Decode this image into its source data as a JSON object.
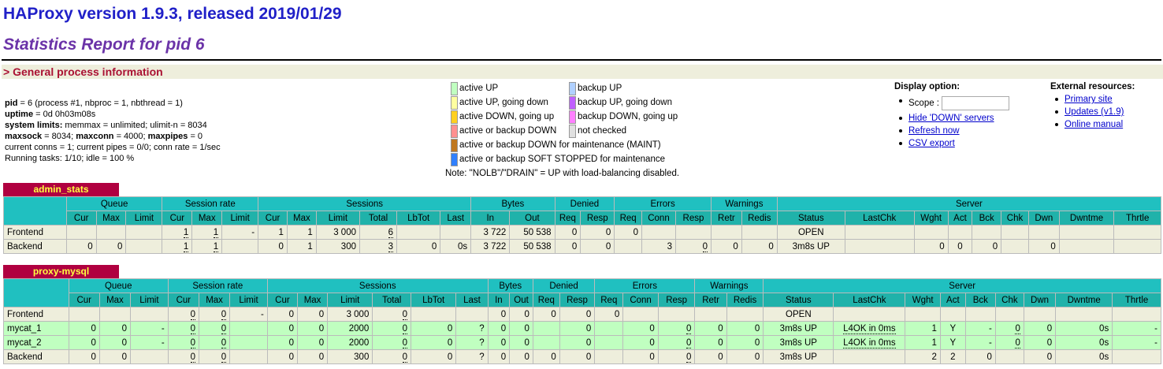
{
  "header": {
    "title": "HAProxy version 1.9.3, released 2019/01/29",
    "subtitle": "Statistics Report for pid 6",
    "section": "> General process information"
  },
  "process_info": {
    "line1_label": "pid",
    "line1_value": " = 6 (process #1, nbproc = 1, nbthread = 1)",
    "line2_label": "uptime",
    "line2_value": " = 0d 0h03m08s",
    "line3_label": "system limits:",
    "line3_value": " memmax = unlimited; ulimit-n = 8034",
    "line4_a_label": "maxsock",
    "line4_a_value": " = 8034; ",
    "line4_b_label": "maxconn",
    "line4_b_value": " = 4000; ",
    "line4_c_label": "maxpipes",
    "line4_c_value": " = 0",
    "line5": "current conns = 1; current pipes = 0/0; conn rate = 1/sec",
    "line6": "Running tasks: 1/10; idle = 100 %"
  },
  "legend": {
    "items": [
      {
        "label": "active UP",
        "color": "#c0ffc0"
      },
      {
        "label": "backup UP",
        "color": "#b0d0ff"
      },
      {
        "label": "active UP, going down",
        "color": "#ffffa0"
      },
      {
        "label": "backup UP, going down",
        "color": "#c060ff"
      },
      {
        "label": "active DOWN, going up",
        "color": "#ffd020"
      },
      {
        "label": "backup DOWN, going up",
        "color": "#ff80ff"
      },
      {
        "label": "active or backup DOWN",
        "color": "#ff9090"
      },
      {
        "label": "not checked",
        "color": "#e0e0e0"
      },
      {
        "label": "active or backup DOWN for maintenance (MAINT)",
        "color": "#c07820"
      },
      {
        "label": "active or backup SOFT STOPPED for maintenance",
        "color": "#3080ff"
      }
    ],
    "note": "Note: \"NOLB\"/\"DRAIN\" = UP with load-balancing disabled."
  },
  "display_options": {
    "title": "Display option:",
    "scope_label": "Scope :",
    "scope_value": "",
    "hide_down": "Hide 'DOWN' servers",
    "refresh": "Refresh now",
    "csv": "CSV export"
  },
  "external": {
    "title": "External resources:",
    "primary": "Primary site",
    "updates": "Updates (v1.9)",
    "manual": "Online manual"
  },
  "headers": {
    "groups": [
      "Queue",
      "Session rate",
      "Sessions",
      "Bytes",
      "Denied",
      "Errors",
      "Warnings",
      "Server"
    ],
    "cols": [
      "Cur",
      "Max",
      "Limit",
      "Cur",
      "Max",
      "Limit",
      "Cur",
      "Max",
      "Limit",
      "Total",
      "LbTot",
      "Last",
      "In",
      "Out",
      "Req",
      "Resp",
      "Req",
      "Conn",
      "Resp",
      "Retr",
      "Redis",
      "Status",
      "LastChk",
      "Wght",
      "Act",
      "Bck",
      "Chk",
      "Dwn",
      "Dwntme",
      "Thrtle"
    ]
  },
  "proxies": [
    {
      "name": "admin_stats",
      "rows": [
        {
          "name": "Frontend",
          "cls": "fe",
          "cells": [
            "",
            "",
            "",
            "1",
            "1",
            "-",
            "1",
            "1",
            "3 000",
            "6",
            "",
            "",
            "3 722",
            "50 538",
            "0",
            "0",
            "0",
            "",
            "",
            "",
            "",
            "OPEN",
            "",
            "",
            "",
            "",
            "",
            "",
            "",
            ""
          ]
        },
        {
          "name": "Backend",
          "cls": "be",
          "cells": [
            "0",
            "0",
            "",
            "1",
            "1",
            "",
            "0",
            "1",
            "300",
            "3",
            "0",
            "0s",
            "3 722",
            "50 538",
            "0",
            "0",
            "",
            "3",
            "0",
            "0",
            "0",
            "3m8s UP",
            "",
            "0",
            "0",
            "0",
            "",
            "0",
            "",
            ""
          ]
        }
      ]
    },
    {
      "name": "proxy-mysql",
      "rows": [
        {
          "name": "Frontend",
          "cls": "fe",
          "cells": [
            "",
            "",
            "",
            "0",
            "0",
            "-",
            "0",
            "0",
            "3 000",
            "0",
            "",
            "",
            "0",
            "0",
            "0",
            "0",
            "0",
            "",
            "",
            "",
            "",
            "OPEN",
            "",
            "",
            "",
            "",
            "",
            "",
            "",
            ""
          ]
        },
        {
          "name": "mycat_1",
          "cls": "up",
          "cells": [
            "0",
            "0",
            "-",
            "0",
            "0",
            "",
            "0",
            "0",
            "2000",
            "0",
            "0",
            "?",
            "0",
            "0",
            "",
            "0",
            "",
            "0",
            "0",
            "0",
            "0",
            "3m8s UP",
            "L4OK in 0ms",
            "1",
            "Y",
            "-",
            "0",
            "0",
            "0s",
            "-"
          ]
        },
        {
          "name": "mycat_2",
          "cls": "up",
          "cells": [
            "0",
            "0",
            "-",
            "0",
            "0",
            "",
            "0",
            "0",
            "2000",
            "0",
            "0",
            "?",
            "0",
            "0",
            "",
            "0",
            "",
            "0",
            "0",
            "0",
            "0",
            "3m8s UP",
            "L4OK in 0ms",
            "1",
            "Y",
            "-",
            "0",
            "0",
            "0s",
            "-"
          ]
        },
        {
          "name": "Backend",
          "cls": "be",
          "cells": [
            "0",
            "0",
            "",
            "0",
            "0",
            "",
            "0",
            "0",
            "300",
            "0",
            "0",
            "?",
            "0",
            "0",
            "0",
            "0",
            "",
            "0",
            "0",
            "0",
            "0",
            "3m8s UP",
            "",
            "2",
            "2",
            "0",
            "",
            "0",
            "0s",
            ""
          ]
        }
      ]
    }
  ]
}
